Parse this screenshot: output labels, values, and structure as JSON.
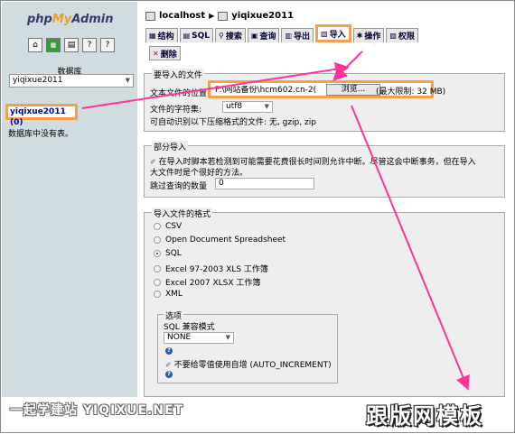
{
  "nav": {
    "logo_php": "php",
    "logo_my": "My",
    "logo_admin": "Admin",
    "icons": [
      "home-icon",
      "sql-window-icon",
      "query-icon",
      "docs-icon",
      "docs-icon"
    ],
    "db_label": "数据库",
    "db_selected": "yiqixue2011",
    "db_link": "yiqixue2011 (0)",
    "no_tables": "数据库中没有表。"
  },
  "breadcrumb": {
    "server": "localhost",
    "database": "yiqixue2011"
  },
  "tabs": [
    {
      "label": "结构",
      "icon": "structure-icon"
    },
    {
      "label": "SQL",
      "icon": "sql-icon"
    },
    {
      "label": "搜索",
      "icon": "search-icon"
    },
    {
      "label": "查询",
      "icon": "query-icon"
    },
    {
      "label": "导出",
      "icon": "export-icon"
    },
    {
      "label": "导入",
      "icon": "import-icon",
      "active": true
    },
    {
      "label": "操作",
      "icon": "operations-icon"
    },
    {
      "label": "权限",
      "icon": "privileges-icon"
    },
    {
      "label": "删除",
      "icon": "drop-icon"
    }
  ],
  "import_file": {
    "legend": "要导入的文件",
    "location_label": "文本文件的位置",
    "file_path": "F:\\网站备份\\hcm602.cn-2(",
    "browse_label": "浏览...",
    "max_limit": "(最大限制: 32 MB)",
    "charset_label": "文件的字符集:",
    "charset_value": "utf8",
    "compression_note": "可自动识别以下压缩格式的文件: 无, gzip, zip"
  },
  "partial_import": {
    "legend": "部分导入",
    "note_line1": "在导入时脚本若检测到可能需要花费很长时间则允许中断。尽管这会中断事务，但在导入",
    "note_line2": "大文件时是个很好的方法。",
    "skip_label": "跳过查询的数量",
    "skip_value": "0"
  },
  "format": {
    "legend": "导入文件的格式",
    "options": [
      "CSV",
      "Open Document Spreadsheet",
      "SQL",
      "Excel 97-2003 XLS 工作簿",
      "Excel 2007 XLSX 工作簿",
      "XML"
    ],
    "selected": "SQL",
    "options_legend": "选项",
    "sql_compat_label": "SQL 兼容模式",
    "sql_compat_value": "NONE",
    "auto_increment_label": "不要给零值使用自增 (AUTO_INCREMENT)"
  },
  "watermarks": {
    "left": "一起学建站 YIQIXUE.NET",
    "right": "跟版网模板"
  },
  "colors": {
    "highlight": "#f4a04a",
    "arrow": "#ff3399",
    "nav_bg": "#d0dce0",
    "panel_bg": "#eeeeee"
  }
}
